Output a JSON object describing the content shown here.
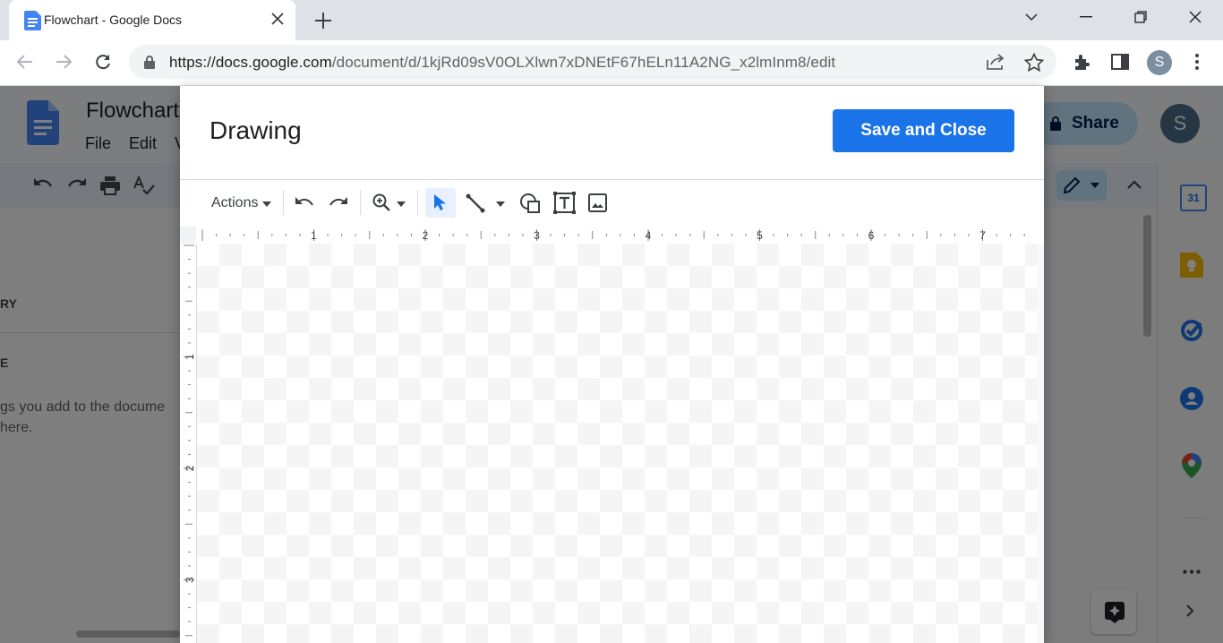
{
  "browser": {
    "tab_title": "Flowchart - Google Docs",
    "url_host": "https://docs.google.com",
    "url_path": "/document/d/1kjRd09sV0OLXlwn7xDNEtF67hELn11A2NG_x2lmInm8/edit",
    "profile_initial": "S"
  },
  "docs": {
    "title": "Flowchart",
    "menu": [
      "File",
      "Edit",
      "V"
    ],
    "outline_heading_1": "RY",
    "outline_heading_2": "E",
    "outline_hint_line1": "gs you add to the docume",
    "outline_hint_line2": "here.",
    "share_label": "Share",
    "user_initial": "S",
    "calendar_day": "31"
  },
  "dialog": {
    "title": "Drawing",
    "save_close_label": "Save and Close",
    "toolbar": {
      "actions_label": "Actions"
    },
    "ruler_h": [
      "1",
      "2",
      "3",
      "4",
      "5",
      "6",
      "7"
    ],
    "ruler_v": [
      "1",
      "2",
      "3"
    ]
  },
  "colors": {
    "accent": "#1a73e8",
    "tab_bar": "#dee1e6",
    "omnibox": "#f1f3f4",
    "share_bg": "#c2e7ff"
  },
  "icons": {
    "docs_logo": "docs-logo-icon",
    "lock": "lock-icon",
    "undo": "undo-icon",
    "redo": "redo-icon",
    "zoom": "zoom-icon",
    "select": "select-cursor-icon",
    "line": "line-icon",
    "shape": "shape-icon",
    "textbox": "textbox-icon",
    "image": "image-icon"
  }
}
